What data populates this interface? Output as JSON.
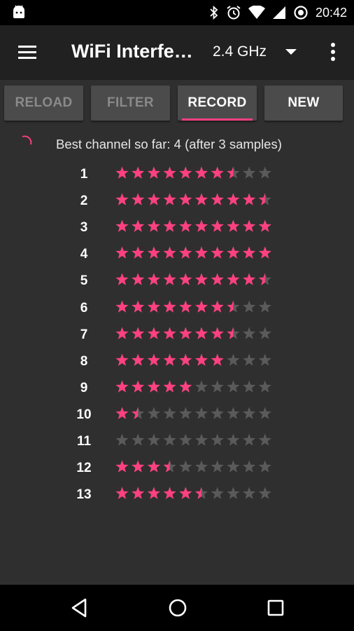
{
  "status_bar": {
    "time": "20:42",
    "icons": [
      "android-icon",
      "bluetooth-icon",
      "alarm-icon",
      "wifi-icon",
      "signal-icon",
      "sync-icon"
    ]
  },
  "toolbar": {
    "title": "WiFi Interfe…",
    "band": "2.4 GHz",
    "icons": [
      "menu-icon",
      "dropdown-caret-icon",
      "overflow-menu-icon"
    ]
  },
  "buttons": {
    "reload": "RELOAD",
    "filter": "FILTER",
    "record": "RECORD",
    "new": "NEW"
  },
  "status": {
    "best_channel_text": "Best channel so far: 4 (after 3 samples)"
  },
  "colors": {
    "accent": "#ff4081",
    "star_empty": "#5a5a5a",
    "background": "#2f2f2f",
    "toolbar": "#212121"
  },
  "channels": [
    {
      "channel": "1",
      "rating": 7.5
    },
    {
      "channel": "2",
      "rating": 9.5
    },
    {
      "channel": "3",
      "rating": 10
    },
    {
      "channel": "4",
      "rating": 10
    },
    {
      "channel": "5",
      "rating": 9.5
    },
    {
      "channel": "6",
      "rating": 7.5
    },
    {
      "channel": "7",
      "rating": 7.5
    },
    {
      "channel": "8",
      "rating": 7
    },
    {
      "channel": "9",
      "rating": 5
    },
    {
      "channel": "10",
      "rating": 1.5
    },
    {
      "channel": "11",
      "rating": 0
    },
    {
      "channel": "12",
      "rating": 3.5
    },
    {
      "channel": "13",
      "rating": 5.5
    }
  ],
  "max_stars": 10
}
